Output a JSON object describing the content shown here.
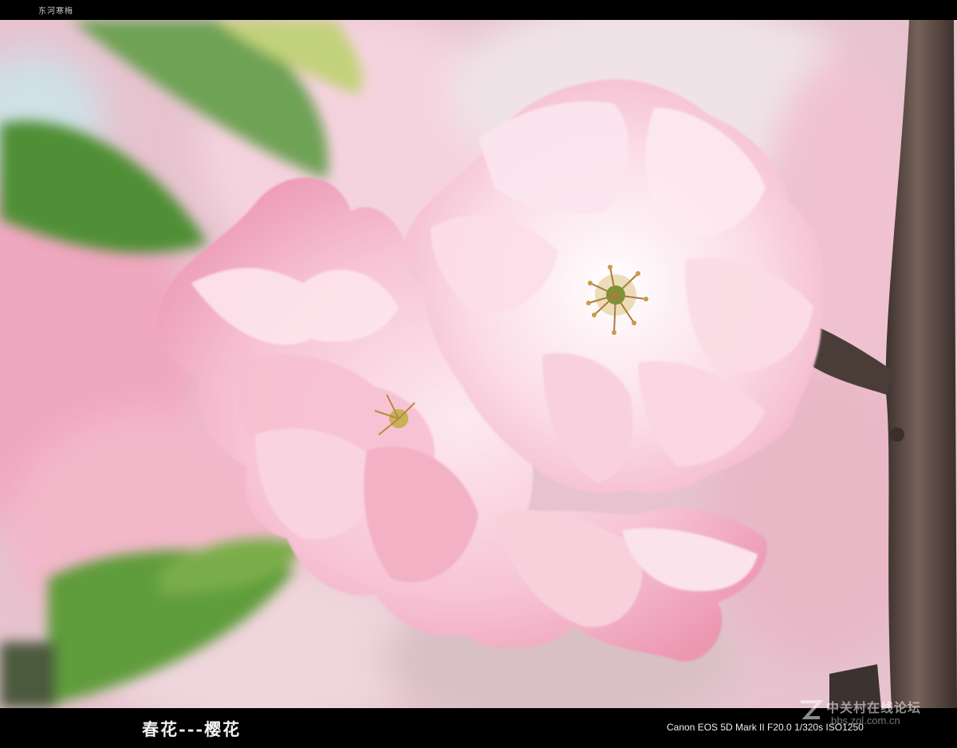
{
  "header": {
    "caption": "东河寒梅"
  },
  "photo": {
    "subject": "pink double cherry blossom on branch",
    "colors": {
      "petal": "#f7c9d8",
      "petal_light": "#fde8ef",
      "petal_deep": "#ef9cb8",
      "leaf": "#5b9a3c",
      "branch": "#5a4a42",
      "background": "#e8c9d3"
    }
  },
  "footer": {
    "title": "春花---樱花",
    "exif": "Canon EOS 5D Mark II F20.0 1/320s ISO1250"
  },
  "watermark": {
    "title": "中关村在线论坛",
    "url": "bbs.zol.com.cn"
  }
}
